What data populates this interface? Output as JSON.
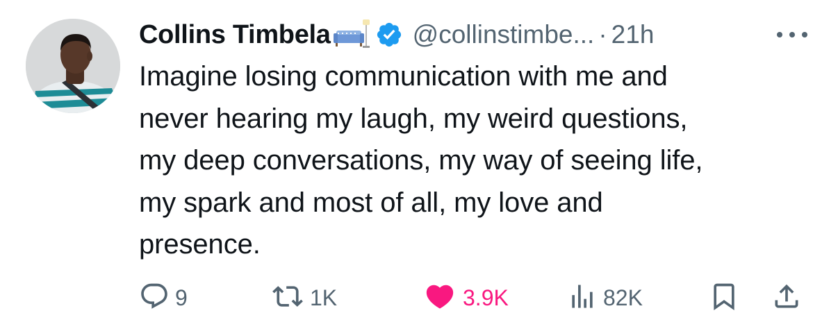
{
  "author": {
    "display_name": "Collins Timbela",
    "handle": "@collinstimbe...",
    "separator": "·",
    "timestamp": "21h",
    "verified": true,
    "name_emoji": "couch-and-lamp-icon"
  },
  "tweet": {
    "lines": [
      "Imagine losing communication with me and",
      "never hearing my laugh, my weird questions,",
      "my deep conversations, my way of seeing life,",
      "my spark and most of all, my love and",
      "presence."
    ]
  },
  "actions": {
    "reply": {
      "icon": "reply-icon",
      "count": "9"
    },
    "retweet": {
      "icon": "retweet-icon",
      "count": "1K"
    },
    "like": {
      "icon": "heart-icon",
      "count": "3.9K",
      "liked": true
    },
    "views": {
      "icon": "views-icon",
      "count": "82K"
    },
    "bookmark": {
      "icon": "bookmark-icon"
    },
    "share": {
      "icon": "share-icon"
    }
  },
  "colors": {
    "text": "#0f1419",
    "secondary": "#536471",
    "verified": "#1d9bf0",
    "like": "#f91880"
  }
}
